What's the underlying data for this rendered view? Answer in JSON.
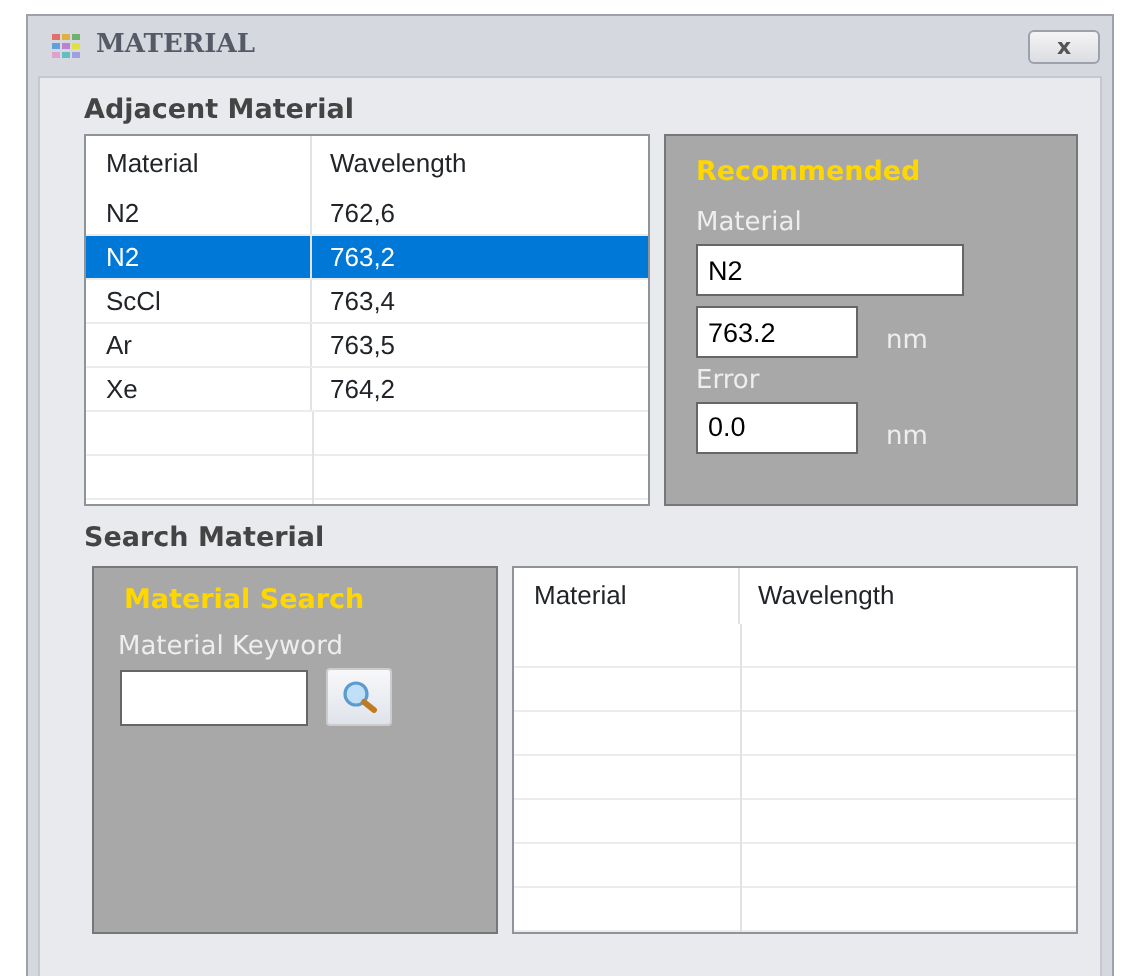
{
  "window": {
    "title": "MATERIAL",
    "close": "x"
  },
  "adjacent": {
    "heading": "Adjacent Material",
    "columns": [
      "Material",
      "Wavelength"
    ],
    "rows": [
      {
        "material": "N2",
        "wavelength": "762,6",
        "selected": false
      },
      {
        "material": "N2",
        "wavelength": "763,2",
        "selected": true
      },
      {
        "material": "ScCl",
        "wavelength": "763,4",
        "selected": false
      },
      {
        "material": "Ar",
        "wavelength": "763,5",
        "selected": false
      },
      {
        "material": "Xe",
        "wavelength": "764,2",
        "selected": false
      }
    ]
  },
  "recommended": {
    "title": "Recommended",
    "material_label": "Material",
    "material": "N2",
    "wavelength": "763.2",
    "unit": "nm",
    "error_label": "Error",
    "error": "0.0",
    "error_unit": "nm"
  },
  "search": {
    "heading": "Search Material",
    "title": "Material Search",
    "keyword_label": "Material Keyword",
    "columns": [
      "Material",
      "Wavelength"
    ]
  }
}
